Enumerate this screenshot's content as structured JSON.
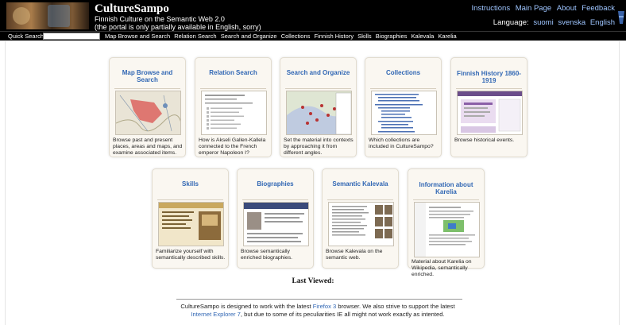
{
  "header": {
    "title": "CultureSampo",
    "subtitle": "Finnish Culture on the Semantic Web 2.0",
    "note": "(the portal is only partially available in English, sorry)",
    "links": [
      "Instructions",
      "Main Page",
      "About",
      "Feedback"
    ],
    "language_label": "Language:",
    "languages": [
      "suomi",
      "svenska",
      "English"
    ]
  },
  "nav": {
    "quick_search_label": "Quick Search:",
    "quick_search_value": "",
    "links": [
      "Map Browse and Search",
      "Relation Search",
      "Search and Organize",
      "Collections",
      "Finnish History",
      "Skills",
      "Biographies",
      "Kalevala",
      "Karelia"
    ]
  },
  "cards": [
    {
      "title": "Map Browse and Search",
      "desc": "Browse past and present places, areas and maps, and examine associated items.",
      "thumb": "map"
    },
    {
      "title": "Relation Search",
      "desc": "How is Akseli Gallen-Kallela connected to the French emperor Napoleon I?",
      "thumb": "text"
    },
    {
      "title": "Search and Organize",
      "desc": "Set the material into contexts by approaching it from different angles.",
      "thumb": "map2"
    },
    {
      "title": "Collections",
      "desc": "Which collections are included in CultureSampo?",
      "thumb": "list"
    },
    {
      "title": "Finnish History 1860-1919",
      "desc": "Browse historical events.",
      "thumb": "history"
    },
    {
      "title": "Skills",
      "desc": "Familiarize yourself with semantically described skills.",
      "thumb": "skills"
    },
    {
      "title": "Biographies",
      "desc": "Browse semantically enriched biographies.",
      "thumb": "bio"
    },
    {
      "title": "Semantic Kalevala",
      "desc": "Browse Kalevala on the semantic web.",
      "thumb": "kalevala"
    },
    {
      "title": "Information about Karelia",
      "desc": "Material about Karelia on Wikipedia, semantically enriched.",
      "thumb": "wiki"
    }
  ],
  "last_viewed": "Last Viewed:",
  "footer": {
    "p1": "CultureSampo is designed to work with the latest ",
    "link1": "Firefox 3",
    "p2": " browser. We also strive to support the latest",
    "link2": "Internet Explorer 7",
    "p3": ", but due to some of its peculiarities IE all might not work exactly as intented."
  },
  "colors": {
    "link": "#3167b4",
    "header_bg": "#000000",
    "card_bg": "#faf7f1",
    "top_link": "#9ec5ff"
  }
}
